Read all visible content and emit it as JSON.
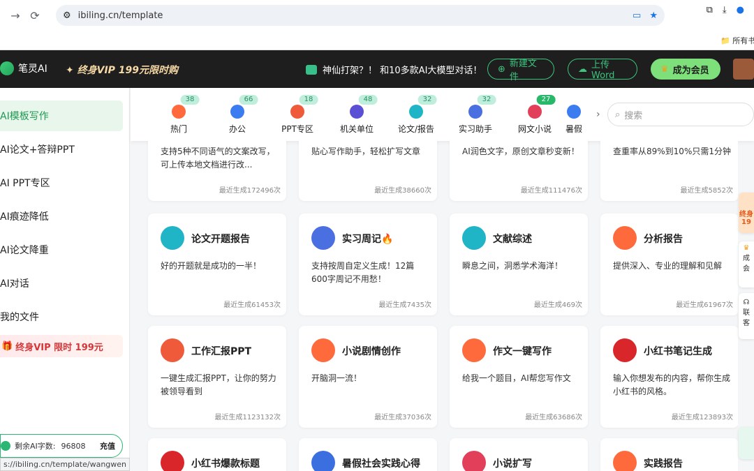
{
  "browser": {
    "url": "ibiling.cn/template",
    "bookmark_label": "所有书"
  },
  "header": {
    "logo_text": "笔灵AI",
    "vip_promo": "终身VIP 199元限时购",
    "chat_promo": "神仙打架？！ 和10多款AI大模型对话！",
    "new_doc_label": "新建文件",
    "upload_label": "上传Word",
    "member_label": "成为会员"
  },
  "sidebar": {
    "items": [
      {
        "label": "AI模板写作",
        "active": true
      },
      {
        "label": "AI论文+答辩PPT"
      },
      {
        "label": "AI PPT专区"
      },
      {
        "label": "AI痕迹降低"
      },
      {
        "label": "AI论文降重"
      },
      {
        "label": "AI对话"
      },
      {
        "label": "我的文件"
      }
    ],
    "vip_banner": "终身VIP 限时 199元",
    "quota_label": "剩余AI字数:",
    "quota_value": "96808",
    "recharge_label": "充值",
    "status_url": "s://ibiling.cn/template/wangwen"
  },
  "categories": [
    {
      "label": "热门",
      "count": "38",
      "color": "#ff6a3d"
    },
    {
      "label": "办公",
      "count": "66",
      "color": "#3b7cf0"
    },
    {
      "label": "PPT专区",
      "count": "18",
      "color": "#ef5a3a"
    },
    {
      "label": "机关单位",
      "count": "48",
      "color": "#5b4fd6"
    },
    {
      "label": "论文/报告",
      "count": "32",
      "color": "#1fb5c7"
    },
    {
      "label": "实习助手",
      "count": "32",
      "color": "#4a6fe0"
    },
    {
      "label": "网文小说",
      "count": "27",
      "color": "#e2405a",
      "hot": true
    },
    {
      "label": "暑假",
      "count": "",
      "color": "#3b7cf0"
    }
  ],
  "search": {
    "placeholder": "搜索"
  },
  "cards": {
    "row0": [
      {
        "desc": "支持5种不同语气的文案改写，可上传本地文档进行改...",
        "stat": "最近生成172496次"
      },
      {
        "desc": "贴心写作助手，轻松扩写文章",
        "stat": "最近生成38660次"
      },
      {
        "desc": "AI润色文字，原创文章秒变新！",
        "stat": "最近生成111476次"
      },
      {
        "desc": "查重率从89%到10%只需1分钟",
        "stat": "最近生成5852次"
      }
    ],
    "row1": [
      {
        "title": "论文开题报告",
        "desc": "好的开题就是成功的一半！",
        "stat": "最近生成61453次",
        "color": "#1fb5c7"
      },
      {
        "title": "实习周记🔥",
        "desc": "支持按周自定义生成！12篇600字周记不用愁！",
        "stat": "最近生成7435次",
        "color": "#4a6fe0"
      },
      {
        "title": "文献综述",
        "desc": "瞬息之间，洞悉学术海洋！",
        "stat": "最近生成469次",
        "color": "#1fb5c7"
      },
      {
        "title": "分析报告",
        "desc": "提供深入、专业的理解和见解",
        "stat": "最近生成61967次",
        "color": "#ff6a3d"
      }
    ],
    "row2": [
      {
        "title": "工作汇报PPT",
        "desc": "一键生成汇报PPT，让你的努力被领导看到",
        "stat": "最近生成1123132次",
        "color": "#ef5a3a"
      },
      {
        "title": "小说剧情创作",
        "desc": "开脑洞一流！",
        "stat": "最近生成37036次",
        "color": "#ff6a3d"
      },
      {
        "title": "作文一键写作",
        "desc": "给我一个题目，AI帮您写作文",
        "stat": "最近生成63686次",
        "color": "#ff6a3d"
      },
      {
        "title": "小红书笔记生成",
        "desc": "输入你想发布的内容，帮你生成小红书的风格。",
        "stat": "最近生成123893次",
        "color": "#d8262b"
      }
    ],
    "row3": [
      {
        "title": "小红书爆款标题",
        "color": "#d8262b"
      },
      {
        "title": "暑假社会实践心得",
        "color": "#3b6fe0"
      },
      {
        "title": "小说扩写",
        "color": "#e2405a"
      },
      {
        "title": "实践报告",
        "color": "#ff6a3d"
      }
    ]
  },
  "float": {
    "promo_top": "终身",
    "promo_bottom": "19",
    "member_short": "成",
    "member_short2": "会",
    "contact_short": "联",
    "contact_short2": "客"
  }
}
